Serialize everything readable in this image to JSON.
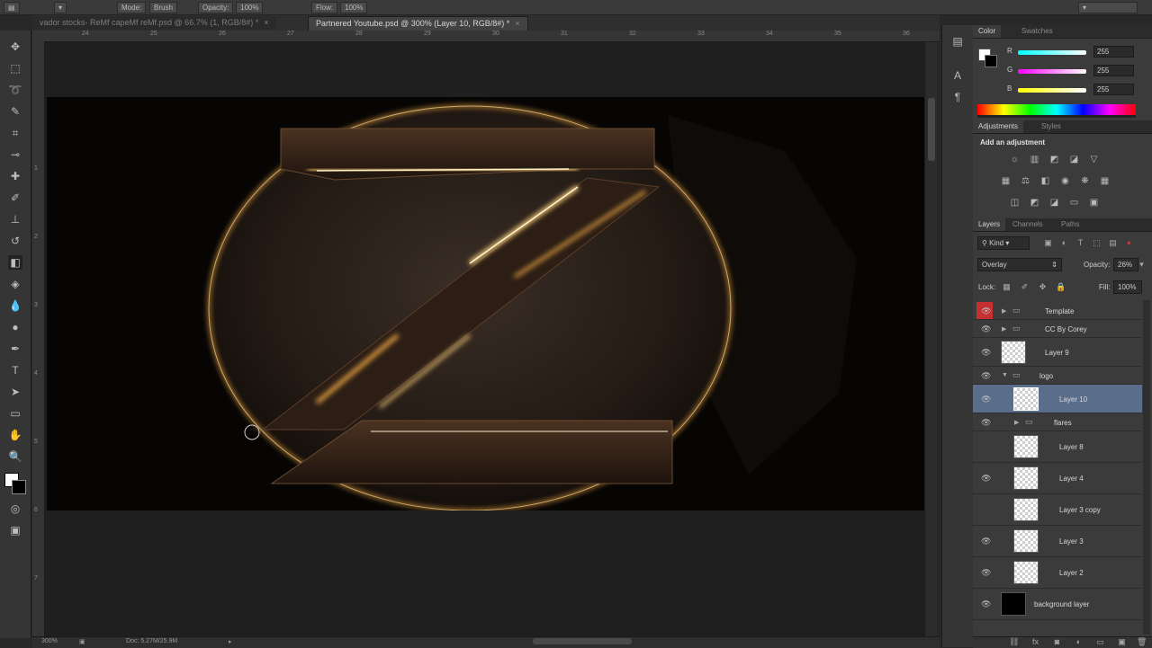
{
  "options_bar": {
    "items": [
      "Mode:",
      "Brush",
      "Opacity:",
      "100%",
      "Flow:",
      "100%"
    ]
  },
  "tabs": [
    {
      "label": "vador stocks- ReMf capeMf reMf.psd @ 66.7% (1, RGB/8#) *",
      "active": false
    },
    {
      "label": "Partnered Youtube.psd @ 300% (Layer 10, RGB/8#) *",
      "active": true
    }
  ],
  "ruler": {
    "top_ticks": [
      "24",
      "25",
      "26",
      "27",
      "28",
      "29",
      "30",
      "31",
      "32",
      "33",
      "34",
      "35",
      "36"
    ],
    "left_ticks": [
      "1",
      "2",
      "3",
      "4",
      "5",
      "6",
      "7"
    ]
  },
  "status": {
    "zoom": "300%",
    "doc": "Doc: 5.27M/25.9M"
  },
  "colors": {
    "accent_selected": "#5a6e8c",
    "visibility_red": "#c62f2f",
    "glow": "#ffb347"
  },
  "color_panel": {
    "tabs": [
      "Color",
      "Swatches"
    ],
    "sliders": [
      {
        "label": "R",
        "value": "255"
      },
      {
        "label": "G",
        "value": "255"
      },
      {
        "label": "B",
        "value": "255"
      }
    ]
  },
  "adjustments_panel": {
    "tabs": [
      "Adjustments",
      "Styles"
    ],
    "heading": "Add an adjustment"
  },
  "layers_panel": {
    "tabs": [
      "Layers",
      "Channels",
      "Paths"
    ],
    "filter_kind": "Kind",
    "blend_mode": "Overlay",
    "opacity_label": "Opacity:",
    "opacity_value": "26%",
    "lock_label": "Lock:",
    "fill_label": "Fill:",
    "fill_value": "100%",
    "layers": [
      {
        "name": "Template",
        "type": "group",
        "indent": 0,
        "visible": true,
        "red": true
      },
      {
        "name": "CC By Corey",
        "type": "group",
        "indent": 0,
        "visible": true
      },
      {
        "name": "Layer 9",
        "type": "layer",
        "indent": 0,
        "visible": true
      },
      {
        "name": "logo",
        "type": "group-open",
        "indent": 0,
        "visible": true
      },
      {
        "name": "Layer 10",
        "type": "layer",
        "indent": 1,
        "visible": true,
        "selected": true
      },
      {
        "name": "flares",
        "type": "group",
        "indent": 1,
        "visible": true
      },
      {
        "name": "Layer 8",
        "type": "layer",
        "indent": 1,
        "visible": false
      },
      {
        "name": "Layer 4",
        "type": "layer",
        "indent": 1,
        "visible": true
      },
      {
        "name": "Layer 3 copy",
        "type": "layer",
        "indent": 1,
        "visible": false
      },
      {
        "name": "Layer 3",
        "type": "layer",
        "indent": 1,
        "visible": true
      },
      {
        "name": "Layer 2",
        "type": "layer",
        "indent": 1,
        "visible": true
      },
      {
        "name": "background layer",
        "type": "layer-black",
        "indent": 0,
        "visible": true
      }
    ]
  }
}
